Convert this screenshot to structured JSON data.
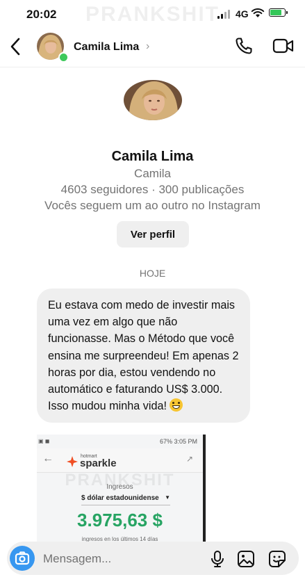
{
  "status_bar": {
    "time": "20:02",
    "network": "4G",
    "watermark": "PRANKSHIT"
  },
  "header": {
    "name": "Camila Lima",
    "chevron": "›",
    "icons": [
      "back-icon",
      "phone-icon",
      "video-icon"
    ]
  },
  "profile": {
    "name": "Camila Lima",
    "username": "Camila",
    "stats": "4603 seguidores · 300 publicações",
    "mutual": "Vocês seguem um ao outro no Instagram",
    "button": "Ver perfil"
  },
  "date_separator": "HOJE",
  "message": {
    "text": "Eu estava com medo de investir mais uma vez em algo que não funcionasse. Mas o Método que você ensina me surpreendeu! Em apenas 2 horas por dia, estou vendendo no automático e faturando US$ 3.000. Isso mudou minha vida!"
  },
  "shared_image": {
    "status_time": "67% 3:05 PM",
    "brand_small": "hotmart",
    "brand": "sparkle",
    "label": "Ingresos",
    "currency": "$ dólar estadounidense",
    "amount": "3.975,63 $",
    "caption": "ingresos en los últimos 14 días",
    "watermark": "PRANKSHIT"
  },
  "composer": {
    "placeholder": "Mensagem..."
  },
  "colors": {
    "accent": "#3797f0",
    "online": "#3ec95b",
    "amount": "#27a463",
    "bubble": "#efefef"
  }
}
